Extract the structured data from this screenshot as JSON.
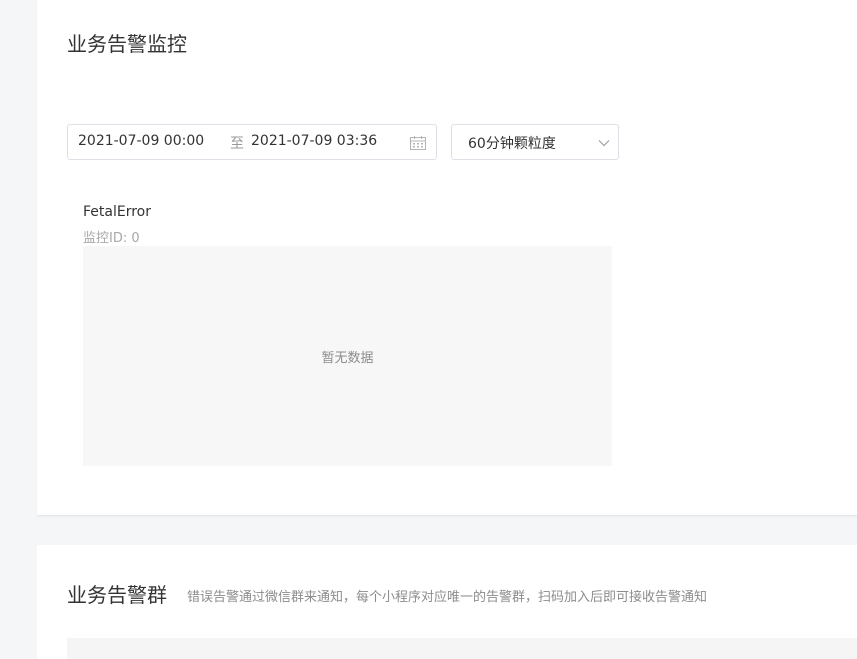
{
  "monitor_section": {
    "title": "业务告警监控",
    "range_start": "2021-07-09 00:00",
    "range_separator": "至",
    "range_end": "2021-07-09 03:36",
    "granularity": "60分钟颗粒度",
    "monitor": {
      "name": "FetalError",
      "id_label": "监控ID: 0",
      "empty_text": "暂无数据"
    }
  },
  "group_section": {
    "title": "业务告警群",
    "description": "错误告警通过微信群来通知，每个小程序对应唯一的告警群，扫码加入后即可接收告警通知"
  },
  "icons": {
    "range_picker": "calendar-icon",
    "select": "chevron-down-icon"
  }
}
